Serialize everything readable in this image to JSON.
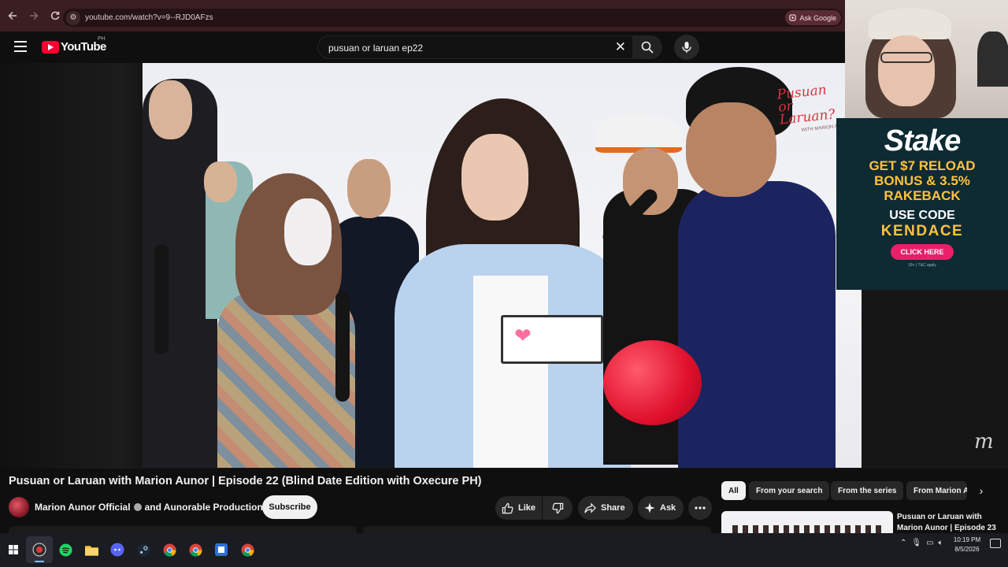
{
  "browser": {
    "url": "youtube.com/watch?v=9--RJD0AFzs",
    "ask_google_label": "Ask Google"
  },
  "youtube": {
    "logo_text": "YouTube",
    "country_code": "PH",
    "search_query": "pusuan or laruan ep22"
  },
  "video": {
    "title": "Pusuan or Laruan with Marion Aunor | Episode 22 (Blind Date Edition with Oxecure PH)",
    "channel": "Marion Aunor Official",
    "channel_connector": "and Aunorable Productions",
    "subscribe_label": "Subscribe",
    "actions": {
      "like": "Like",
      "share": "Share",
      "ask": "Ask"
    }
  },
  "ad": {
    "brand": "Stake",
    "line1": "GET $7 RELOAD",
    "line2": "BONUS & 3.5%",
    "line3": "RAKEBACK",
    "line4": "USE CODE",
    "code": "KENDACE",
    "cta": "CLICK HERE",
    "fine_print": "18+ | T&C apply"
  },
  "sidebar": {
    "chips": [
      "All",
      "From your search",
      "From the series",
      "From Marion A"
    ],
    "active_chip": "All",
    "recommendation_title": "Pusuan or Laruan with Marion Aunor | Episode 23"
  },
  "taskbar": {
    "time": "10:19 PM",
    "date": "8/5/2026"
  },
  "colors": {
    "youtube_red": "#ff0033",
    "browser_frame": "#3a1e22",
    "ad_background": "#0e2a33",
    "ad_accent": "#ffc23d",
    "ad_cta": "#ea1f6a"
  }
}
